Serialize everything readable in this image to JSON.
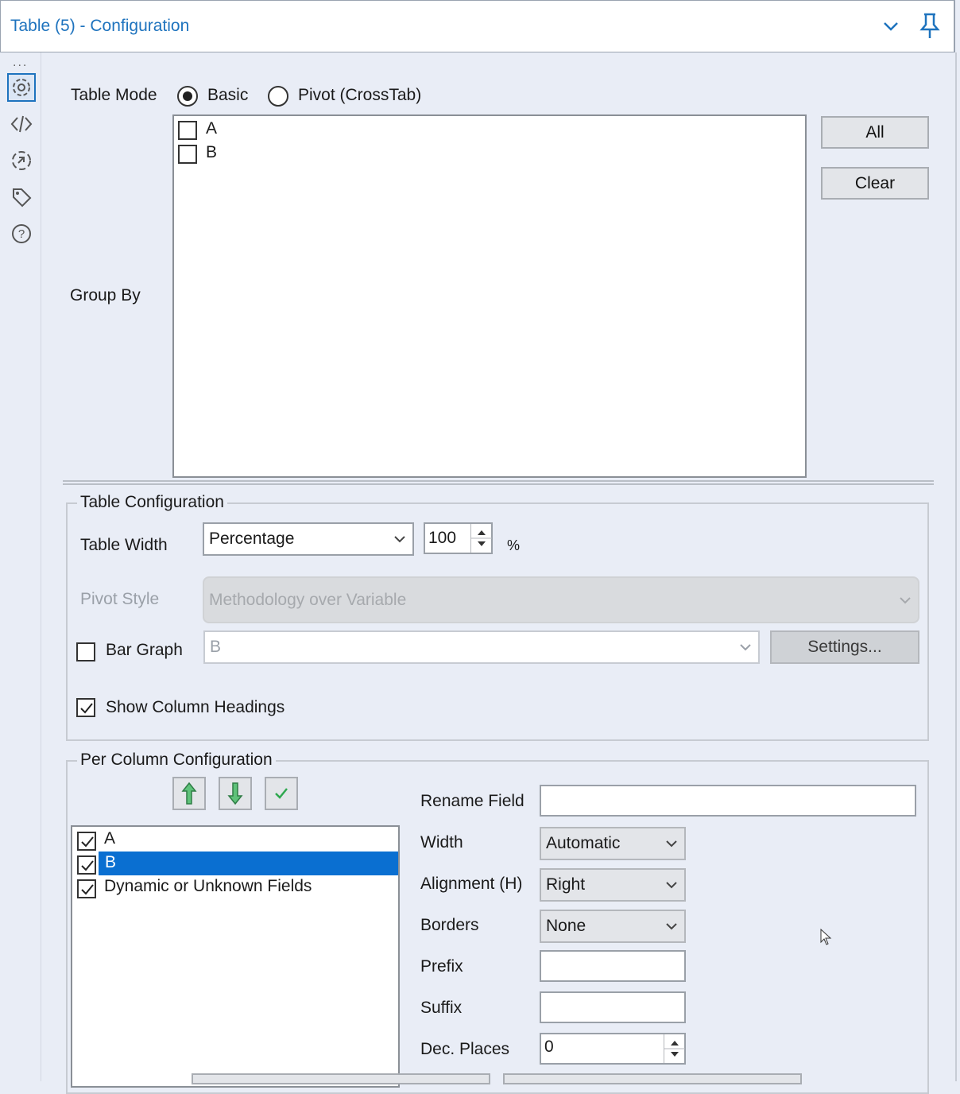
{
  "header": {
    "title": "Table (5) - Configuration"
  },
  "rail": {
    "icons": [
      "gear-icon",
      "code-icon",
      "rotate-icon",
      "tag-icon",
      "help-icon"
    ],
    "dots": "..."
  },
  "table_mode": {
    "label": "Table Mode",
    "options": [
      "Basic",
      "Pivot (CrossTab)"
    ],
    "selected": "Basic"
  },
  "group_by": {
    "label": "Group By",
    "items": [
      {
        "label": "A",
        "checked": false
      },
      {
        "label": "B",
        "checked": false
      }
    ],
    "all_label": "All",
    "clear_label": "Clear"
  },
  "table_config": {
    "title": "Table Configuration",
    "width_label": "Table Width",
    "width_mode": "Percentage",
    "width_value": "100",
    "width_unit": "%",
    "pivot_style_label": "Pivot Style",
    "pivot_style_value": "Methodology over Variable",
    "bar_graph_label": "Bar Graph",
    "bar_graph_checked": false,
    "bar_graph_field": "B",
    "settings_label": "Settings...",
    "show_headings_label": "Show Column Headings",
    "show_headings_checked": true
  },
  "per_column": {
    "title": "Per Column Configuration",
    "fields": [
      {
        "label": "A",
        "checked": true,
        "selected": false
      },
      {
        "label": "B",
        "checked": true,
        "selected": true
      },
      {
        "label": "Dynamic or Unknown Fields",
        "checked": true,
        "selected": false
      }
    ],
    "rename_label": "Rename Field",
    "rename_value": "",
    "width_label": "Width",
    "width_value": "Automatic",
    "alignment_label": "Alignment (H)",
    "alignment_value": "Right",
    "borders_label": "Borders",
    "borders_value": "None",
    "prefix_label": "Prefix",
    "prefix_value": "",
    "suffix_label": "Suffix",
    "suffix_value": "",
    "dec_places_label": "Dec. Places",
    "dec_places_value": "0"
  },
  "colors": {
    "accent": "#1e73be",
    "selection": "#0a6fd1",
    "background": "#e9edf6"
  }
}
